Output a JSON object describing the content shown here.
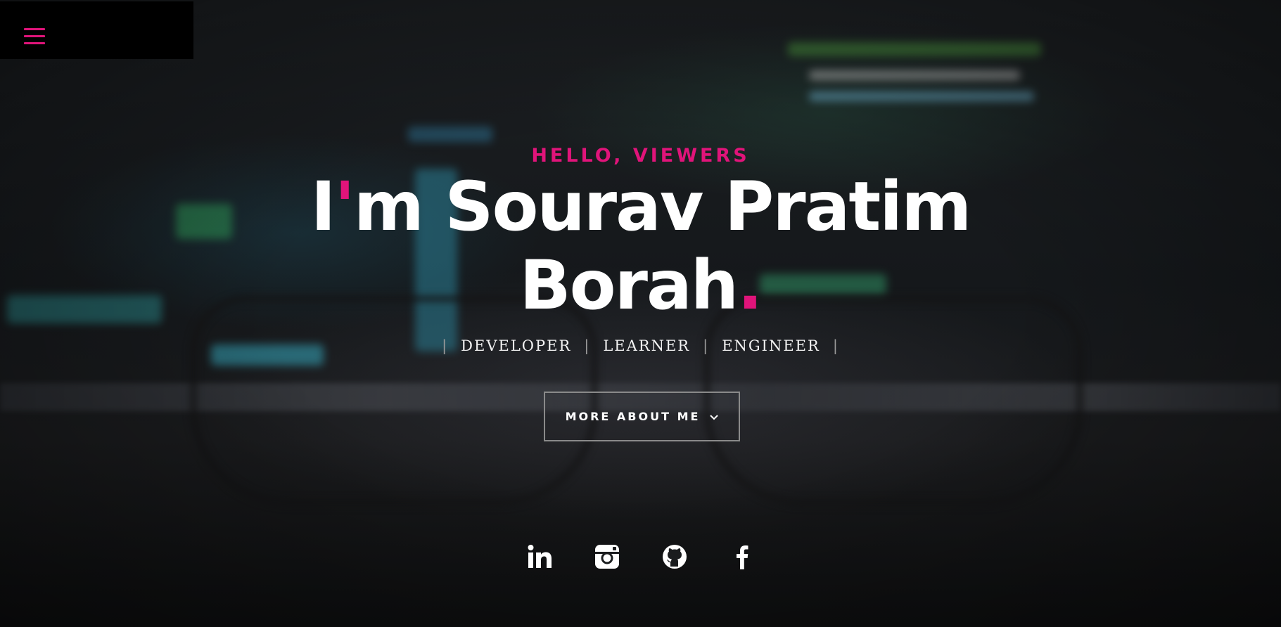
{
  "menu": {
    "icon": "hamburger-menu-icon",
    "color": "#e0147a"
  },
  "hero": {
    "pre_title": "HELLO, VIEWERS",
    "title_prefix": "I",
    "title_apostrophe": "'",
    "title_rest": "m Sourav Pratim",
    "title_line2": "Borah",
    "title_dot": ".",
    "roles": [
      "DEVELOPER",
      "LEARNER",
      "ENGINEER"
    ],
    "role_separator": "|",
    "more_button_label": "MORE ABOUT ME",
    "accent_color": "#e0147a"
  },
  "socials": [
    {
      "name": "linkedin",
      "icon": "linkedin-icon"
    },
    {
      "name": "instagram",
      "icon": "instagram-icon"
    },
    {
      "name": "github",
      "icon": "github-icon"
    },
    {
      "name": "facebook",
      "icon": "facebook-icon"
    }
  ]
}
